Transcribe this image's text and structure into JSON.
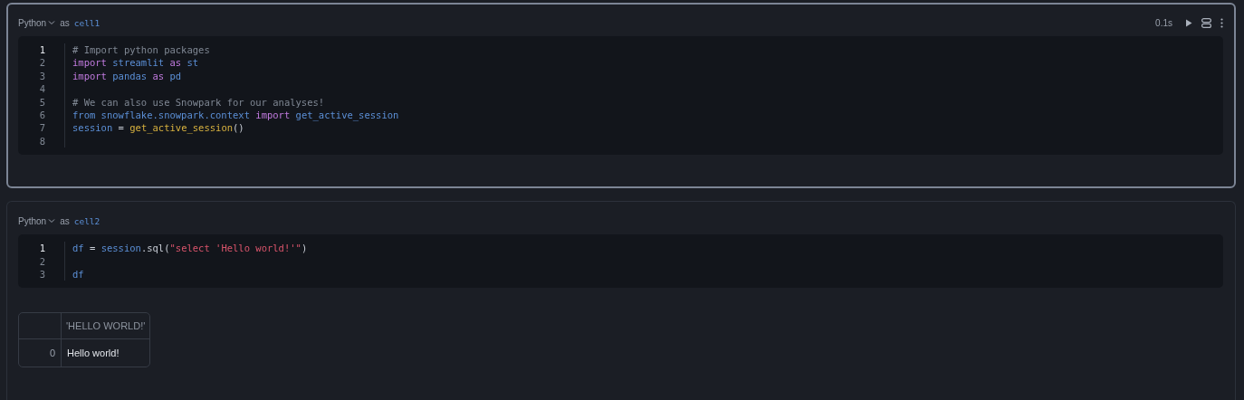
{
  "cells": [
    {
      "selected": true,
      "language": "Python",
      "as_label": "as",
      "name": "cell1",
      "run_time": "0.1s",
      "lines": [
        {
          "number": "1",
          "active": true,
          "tokens": [
            {
              "kind": "comment",
              "text": "# Import python packages"
            }
          ]
        },
        {
          "number": "2",
          "active": false,
          "tokens": [
            {
              "kind": "keyword",
              "text": "import"
            },
            {
              "kind": "name",
              "text": " streamlit"
            },
            {
              "kind": "keyword",
              "text": " as"
            },
            {
              "kind": "name",
              "text": " st"
            }
          ]
        },
        {
          "number": "3",
          "active": false,
          "tokens": [
            {
              "kind": "keyword",
              "text": "import"
            },
            {
              "kind": "name",
              "text": " pandas"
            },
            {
              "kind": "keyword",
              "text": " as"
            },
            {
              "kind": "name",
              "text": " pd"
            }
          ]
        },
        {
          "number": "4",
          "active": false
        },
        {
          "number": "5",
          "active": false,
          "tokens": [
            {
              "kind": "comment",
              "text": "# We can also use Snowpark for our analyses!"
            }
          ]
        },
        {
          "number": "6",
          "active": false,
          "tokens": [
            {
              "kind": "name",
              "text": "from"
            },
            {
              "kind": "name",
              "text": " snowflake.snowpark.context"
            },
            {
              "kind": "keyword",
              "text": " import"
            },
            {
              "kind": "name",
              "text": " get_active_session"
            }
          ]
        },
        {
          "number": "7",
          "active": false,
          "tokens": [
            {
              "kind": "name",
              "text": "session"
            },
            {
              "kind": "plain",
              "text": " = "
            },
            {
              "kind": "func",
              "text": "get_active_session"
            },
            {
              "kind": "plain",
              "text": "()"
            }
          ]
        },
        {
          "number": "8",
          "active": false
        }
      ]
    },
    {
      "selected": false,
      "language": "Python",
      "as_label": "as",
      "name": "cell2",
      "lines": [
        {
          "number": "1",
          "active": true,
          "tokens": [
            {
              "kind": "name",
              "text": "df"
            },
            {
              "kind": "plain",
              "text": " = "
            },
            {
              "kind": "name",
              "text": "session"
            },
            {
              "kind": "plain",
              "text": ".sql("
            },
            {
              "kind": "string",
              "text": "\"select 'Hello world!'\""
            },
            {
              "kind": "plain",
              "text": ")"
            }
          ]
        },
        {
          "number": "2",
          "active": false
        },
        {
          "number": "3",
          "active": false,
          "tokens": [
            {
              "kind": "name",
              "text": "df"
            }
          ]
        }
      ],
      "output_table": {
        "columns": [
          "'HELLO WORLD!'"
        ],
        "rows": [
          {
            "index": "0",
            "cells": [
              "Hello world!"
            ]
          }
        ]
      }
    }
  ]
}
